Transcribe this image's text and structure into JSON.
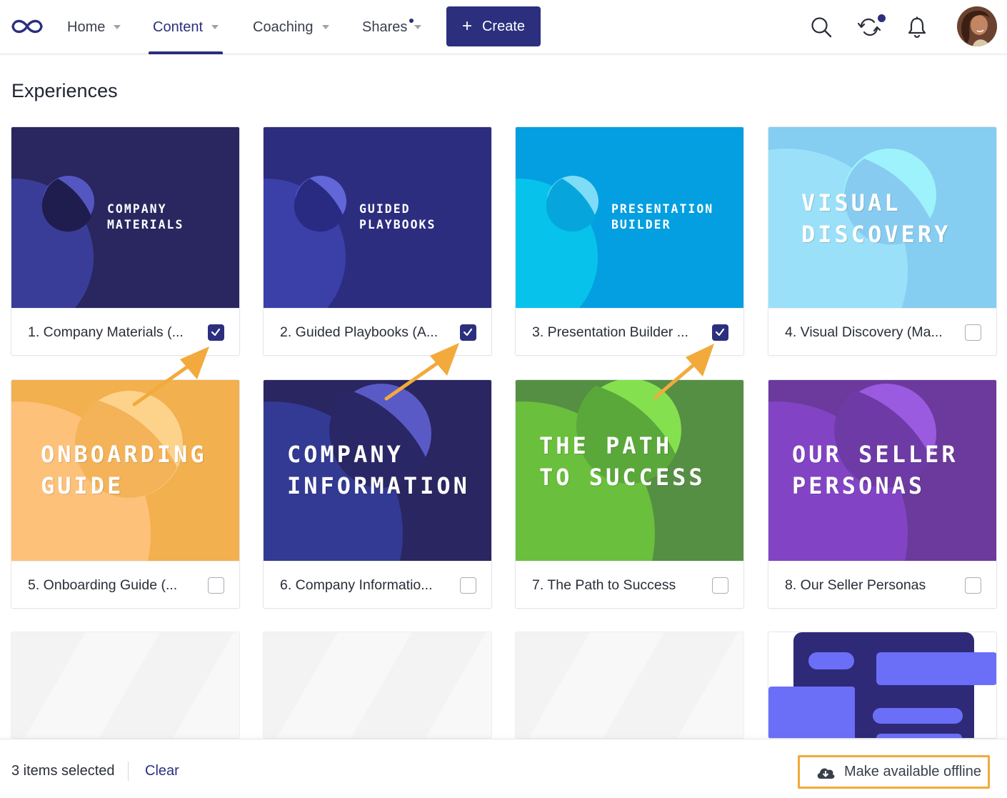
{
  "nav": {
    "home": "Home",
    "content": "Content",
    "coaching": "Coaching",
    "shares": "Shares",
    "create": "Create",
    "accent": "#2b2f7e",
    "icons": [
      "infinity-logo-icon",
      "search-icon",
      "sync-icon",
      "bell-icon"
    ]
  },
  "section_title": "Experiences",
  "cards": [
    {
      "label": "1. Company Materials (...",
      "thumb_text": "COMPANY\nMATERIALS",
      "checked": true,
      "theme": "navy"
    },
    {
      "label": "2. Guided Playbooks (A...",
      "thumb_text": "GUIDED\nPLAYBOOKS",
      "checked": true,
      "theme": "indigo"
    },
    {
      "label": "3. Presentation Builder ...",
      "thumb_text": "PRESENTATION\nBUILDER",
      "checked": true,
      "theme": "cyan"
    },
    {
      "label": "4. Visual Discovery (Ma...",
      "thumb_text": "VISUAL\nDISCOVERY",
      "checked": false,
      "theme": "skyblue"
    },
    {
      "label": "5. Onboarding Guide (...",
      "thumb_text": "ONBOARDING\nGUIDE",
      "checked": false,
      "theme": "orange"
    },
    {
      "label": "6. Company Informatio...",
      "thumb_text": "COMPANY\nINFORMATION",
      "checked": false,
      "theme": "navy2"
    },
    {
      "label": "7. The Path to Success",
      "thumb_text": "THE PATH\nTO SUCCESS",
      "checked": false,
      "theme": "green"
    },
    {
      "label": "8. Our Seller Personas",
      "thumb_text": "OUR SELLER\nPERSONAS",
      "checked": false,
      "theme": "purple"
    }
  ],
  "bottom_bar": {
    "selected_text": "3 items selected",
    "clear": "Clear",
    "offline_button": "Make available offline",
    "highlight_color": "#f2aa3c"
  }
}
